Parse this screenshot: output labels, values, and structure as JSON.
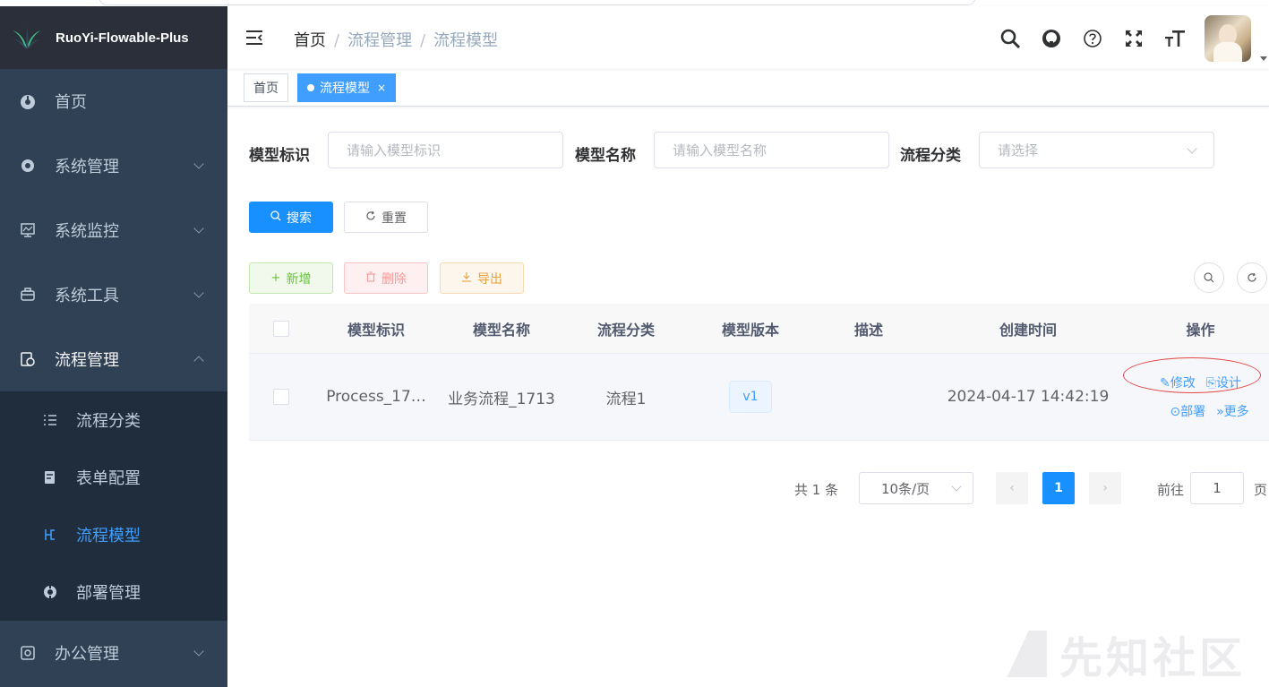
{
  "app": {
    "title": "RuoYi-Flowable-Plus"
  },
  "sidebar": {
    "items": [
      {
        "label": "首页",
        "icon": "dashboard-icon"
      },
      {
        "label": "系统管理",
        "icon": "gear-icon"
      },
      {
        "label": "系统监控",
        "icon": "monitor-icon"
      },
      {
        "label": "系统工具",
        "icon": "toolbox-icon"
      },
      {
        "label": "流程管理",
        "icon": "workflow-icon",
        "expanded": true
      },
      {
        "label": "办公管理",
        "icon": "office-icon"
      }
    ],
    "subitems": [
      {
        "label": "流程分类",
        "icon": "list-icon"
      },
      {
        "label": "表单配置",
        "icon": "form-icon"
      },
      {
        "label": "流程模型",
        "icon": "model-icon",
        "active": true
      },
      {
        "label": "部署管理",
        "icon": "deploy-icon"
      }
    ]
  },
  "breadcrumb": {
    "home": "首页",
    "level2": "流程管理",
    "level3": "流程模型",
    "sep": "/"
  },
  "tags": {
    "home": "首页",
    "current": "流程模型",
    "close": "×"
  },
  "search": {
    "key_label": "模型标识",
    "key_placeholder": "请输入模型标识",
    "name_label": "模型名称",
    "name_placeholder": "请输入模型名称",
    "category_label": "流程分类",
    "category_placeholder": "请选择",
    "search_btn": "搜索",
    "reset_btn": "重置"
  },
  "toolbar": {
    "add": "新增",
    "delete": "删除",
    "export": "导出"
  },
  "table": {
    "headers": [
      "模型标识",
      "模型名称",
      "流程分类",
      "模型版本",
      "描述",
      "创建时间",
      "操作"
    ],
    "rows": [
      {
        "key": "Process_17…",
        "name": "业务流程_1713",
        "category": "流程1",
        "version": "v1",
        "description": "",
        "created": "2024-04-17 14:42:19",
        "ops": {
          "edit": "修改",
          "design": "设计",
          "deploy": "部署",
          "more": "更多"
        }
      }
    ]
  },
  "pagination": {
    "total_text": "共 1 条",
    "page_size": "10条/页",
    "current": "1",
    "goto_label": "前往",
    "goto_value": "1",
    "page_suffix": "页"
  },
  "watermark": "先知社区",
  "colors": {
    "primary": "#1890ff",
    "sidebar_bg": "#304156",
    "active_menu": "#409eff",
    "annotation": "#e64545"
  }
}
